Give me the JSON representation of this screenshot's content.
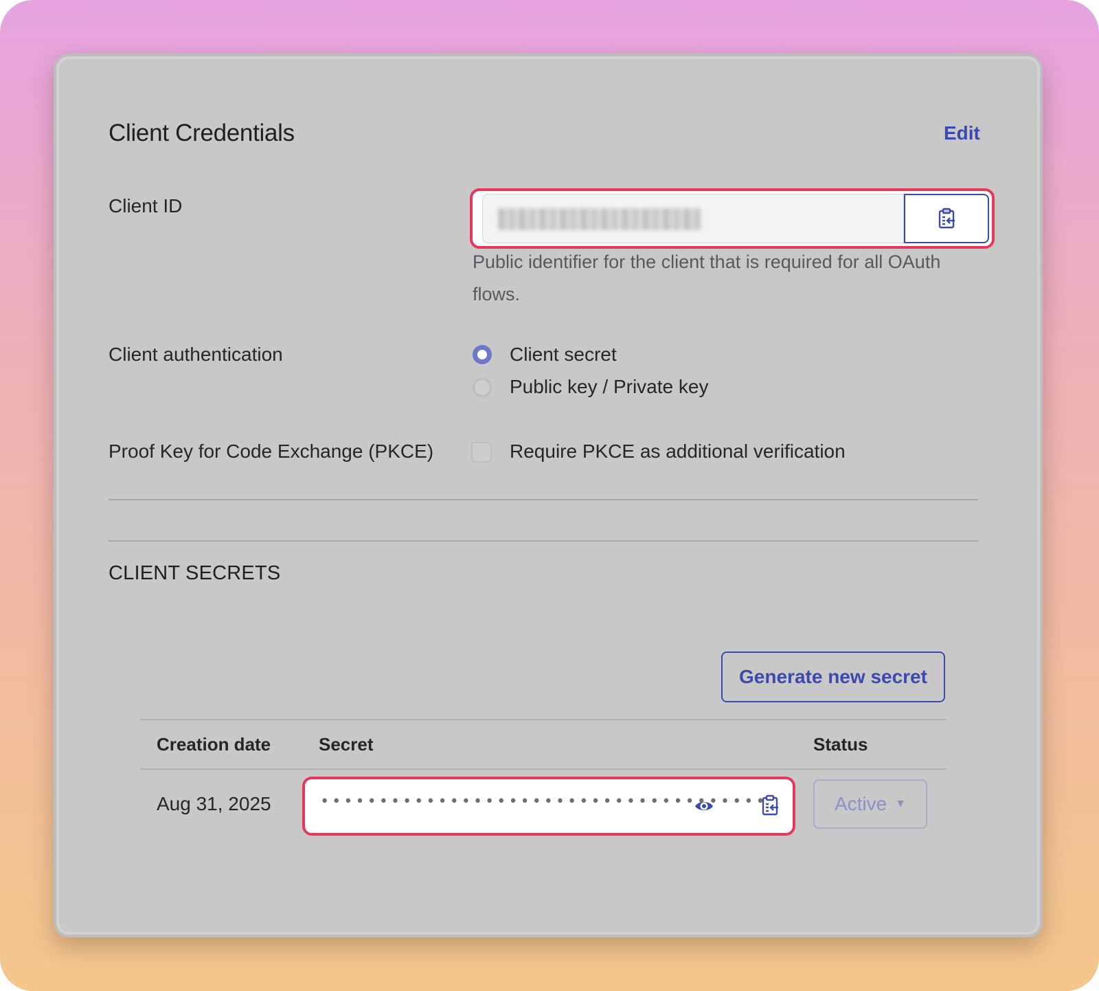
{
  "header": {
    "title": "Client Credentials",
    "edit_label": "Edit"
  },
  "client_id": {
    "label": "Client ID",
    "value_masked": "",
    "help_text": "Public identifier for the client that is required for all OAuth flows."
  },
  "client_auth": {
    "label": "Client authentication",
    "options": [
      {
        "label": "Client secret",
        "selected": true
      },
      {
        "label": "Public key / Private key",
        "selected": false
      }
    ]
  },
  "pkce": {
    "label": "Proof Key for Code Exchange (PKCE)",
    "checkbox_label": "Require PKCE as additional verification",
    "checked": false
  },
  "secrets": {
    "section_title": "CLIENT SECRETS",
    "generate_label": "Generate new secret",
    "columns": [
      "Creation date",
      "Secret",
      "Status"
    ],
    "rows": [
      {
        "creation_date": "Aug 31, 2025",
        "secret_masked": "••••••••••••••••••••••••••••••••••••••",
        "status": "Active"
      }
    ]
  },
  "colors": {
    "accent": "#3a4ab0",
    "highlight": "#e6385c",
    "card_bg": "#c8c8c8"
  },
  "icons": {
    "copy": "clipboard-copy-icon",
    "reveal": "eye-icon",
    "dropdown": "caret-down-icon"
  }
}
